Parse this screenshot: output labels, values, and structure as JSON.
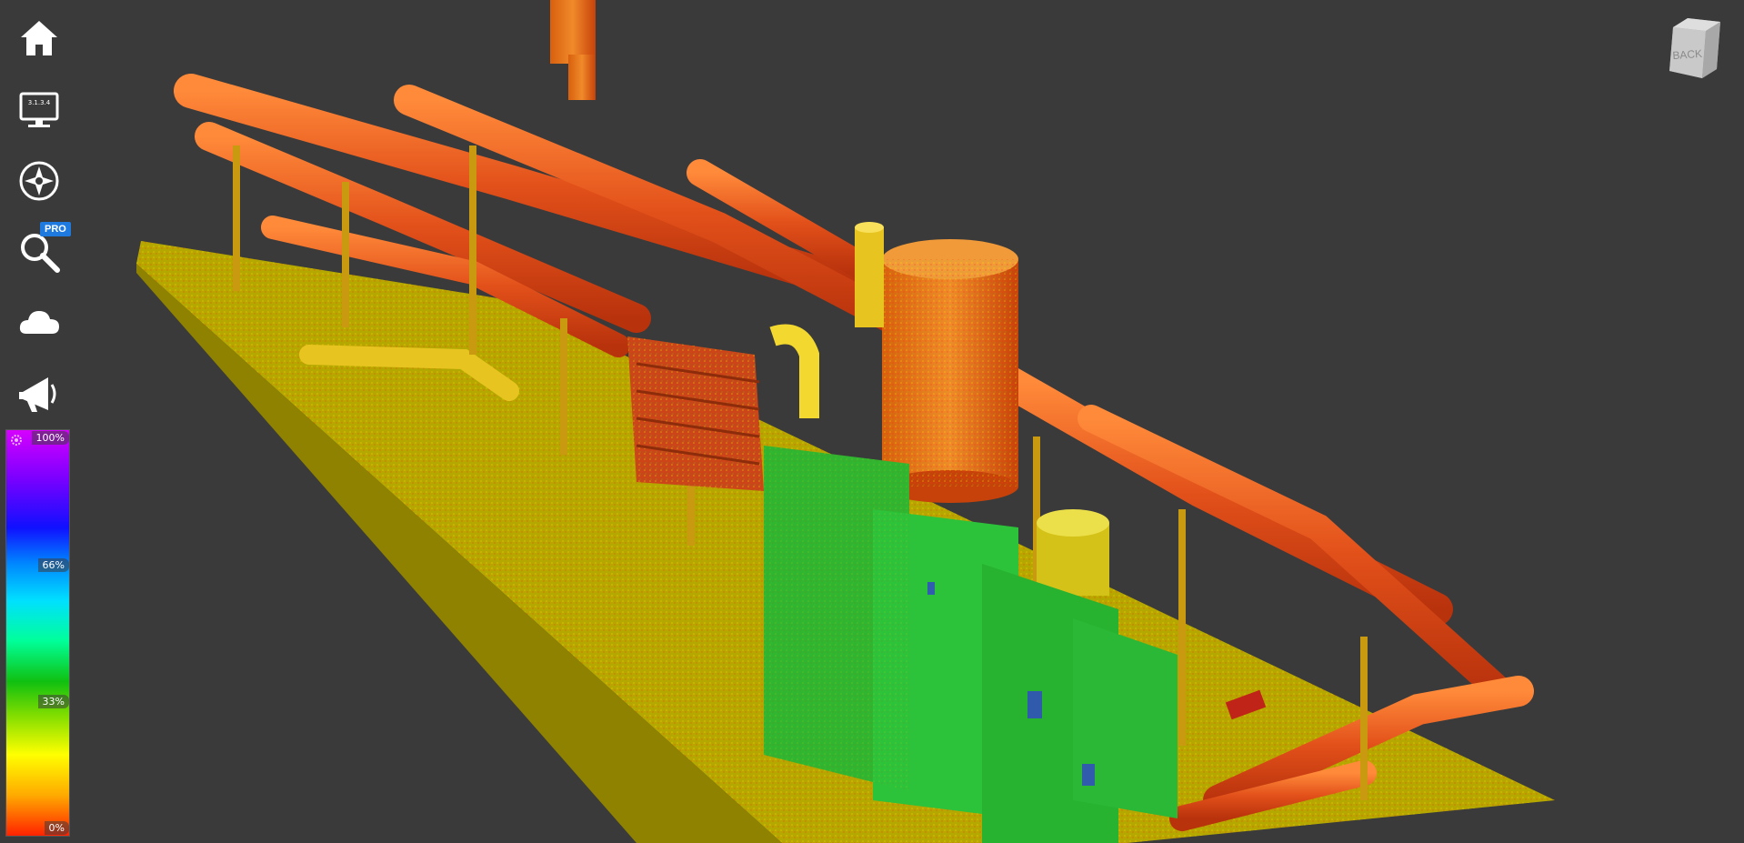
{
  "app": {
    "version": "3.1.3.4"
  },
  "toolbar": {
    "items": [
      {
        "icon": "home-icon",
        "label": ""
      },
      {
        "icon": "monitor-icon",
        "label": ""
      },
      {
        "icon": "compass-icon",
        "label": ""
      },
      {
        "icon": "search-icon",
        "label": ""
      },
      {
        "icon": "cloud-icon",
        "label": ""
      },
      {
        "icon": "megaphone-icon",
        "label": ""
      }
    ],
    "pro_badge": "PRO"
  },
  "colorbar": {
    "top_label": "100%",
    "mid_high_label": "66%",
    "mid_low_label": "33%",
    "bottom_label": "0%",
    "gear_icon": "gear-icon"
  },
  "navcube": {
    "face_label": "BACK"
  },
  "colors": {
    "background": "#3a3a3a",
    "badge": "#1f7ae0",
    "pipe": "#e8581c",
    "floor": "#c9b800",
    "equipment": "#22c42a"
  }
}
